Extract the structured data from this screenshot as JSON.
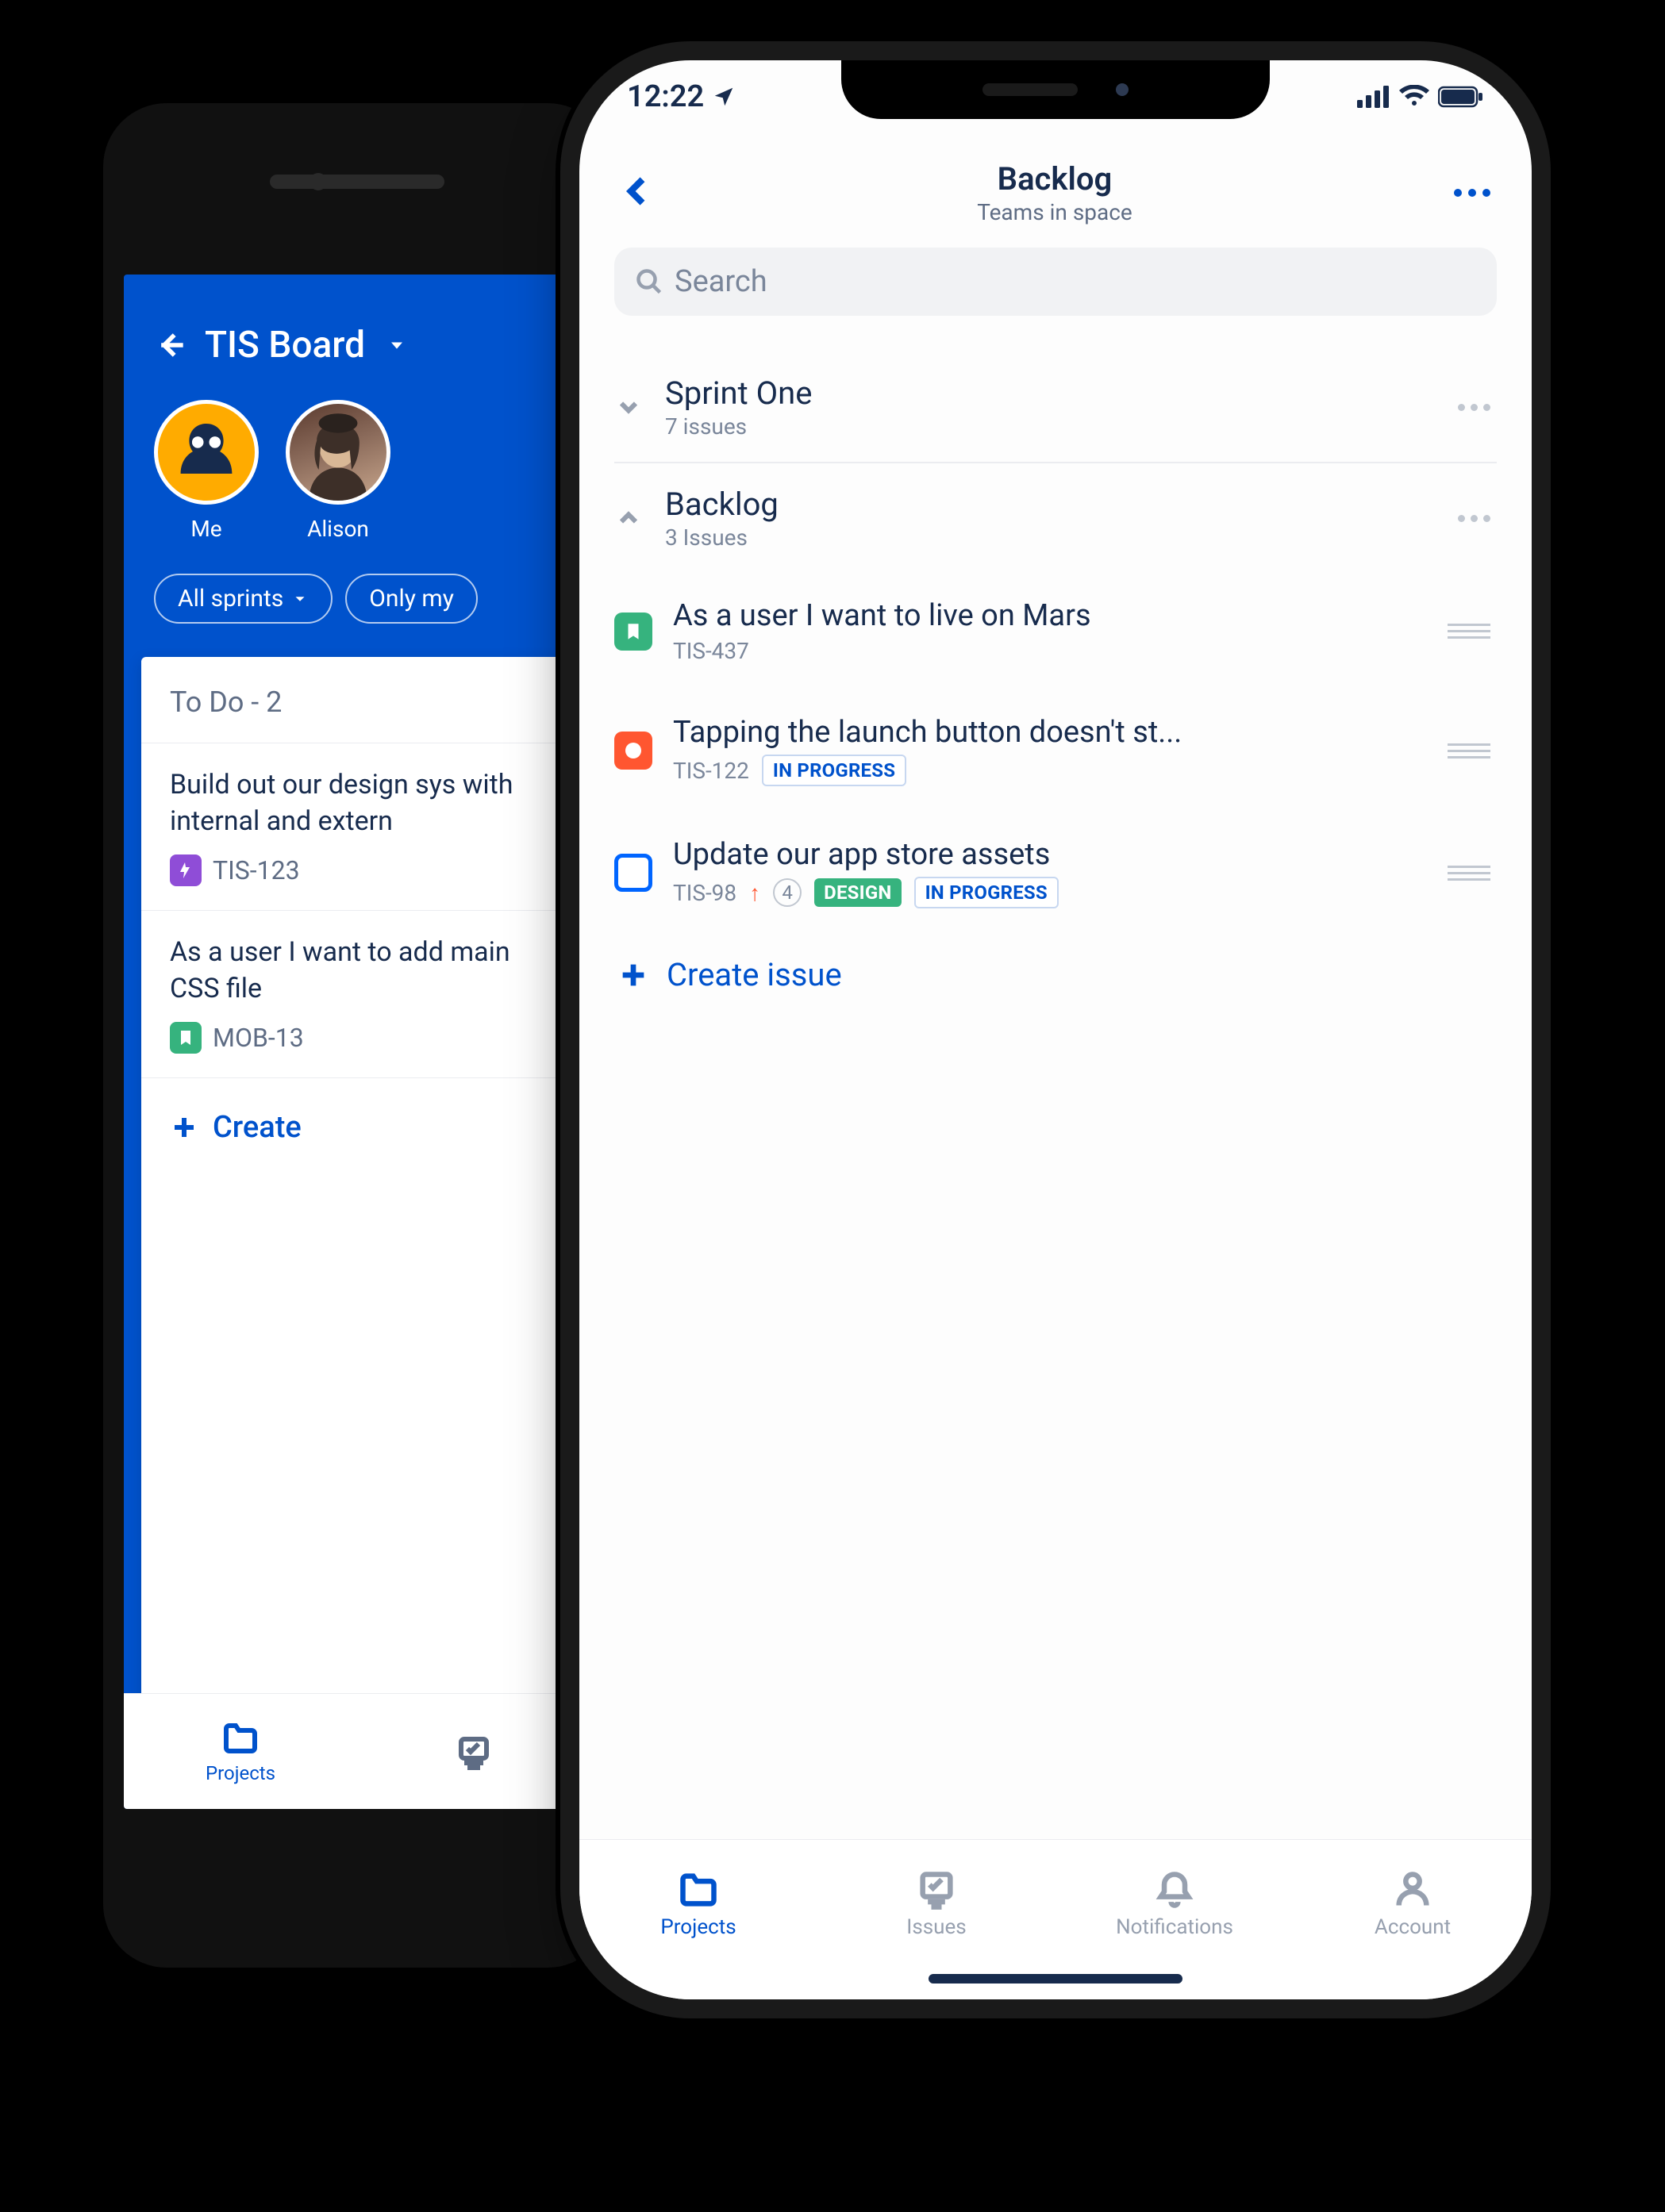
{
  "android": {
    "header": {
      "title": "TIS Board"
    },
    "avatars": [
      {
        "label": "Me"
      },
      {
        "label": "Alison"
      }
    ],
    "chips": [
      {
        "label": "All sprints"
      },
      {
        "label": "Only my"
      }
    ],
    "column_title": "To Do - 2",
    "issues": [
      {
        "title": "Build out our design sys with internal and extern",
        "key": "TIS-123",
        "type": "epic"
      },
      {
        "title": "As a user I want to add main CSS file",
        "key": "MOB-13",
        "type": "story"
      }
    ],
    "create_label": "Create",
    "tabs": [
      {
        "label": "Projects"
      },
      {
        "label": ""
      }
    ]
  },
  "iphone": {
    "status": {
      "time": "12:22"
    },
    "nav": {
      "title": "Backlog",
      "subtitle": "Teams in space"
    },
    "search": {
      "placeholder": "Search"
    },
    "sections": [
      {
        "title": "Sprint One",
        "count": "7 issues",
        "expanded": false
      },
      {
        "title": "Backlog",
        "count": "3 Issues",
        "expanded": true
      }
    ],
    "issues": [
      {
        "title": "As a user I want to live on Mars",
        "key": "TIS-437",
        "type": "story"
      },
      {
        "title": "Tapping the launch button doesn't st...",
        "key": "TIS-122",
        "type": "bug",
        "status": "IN PROGRESS"
      },
      {
        "title": "Update our app store assets",
        "key": "TIS-98",
        "type": "task",
        "priority": "up",
        "estimate": "4",
        "epic": "DESIGN",
        "status": "IN PROGRESS"
      }
    ],
    "create_label": "Create issue",
    "tabs": [
      {
        "label": "Projects"
      },
      {
        "label": "Issues"
      },
      {
        "label": "Notifications"
      },
      {
        "label": "Account"
      }
    ]
  }
}
